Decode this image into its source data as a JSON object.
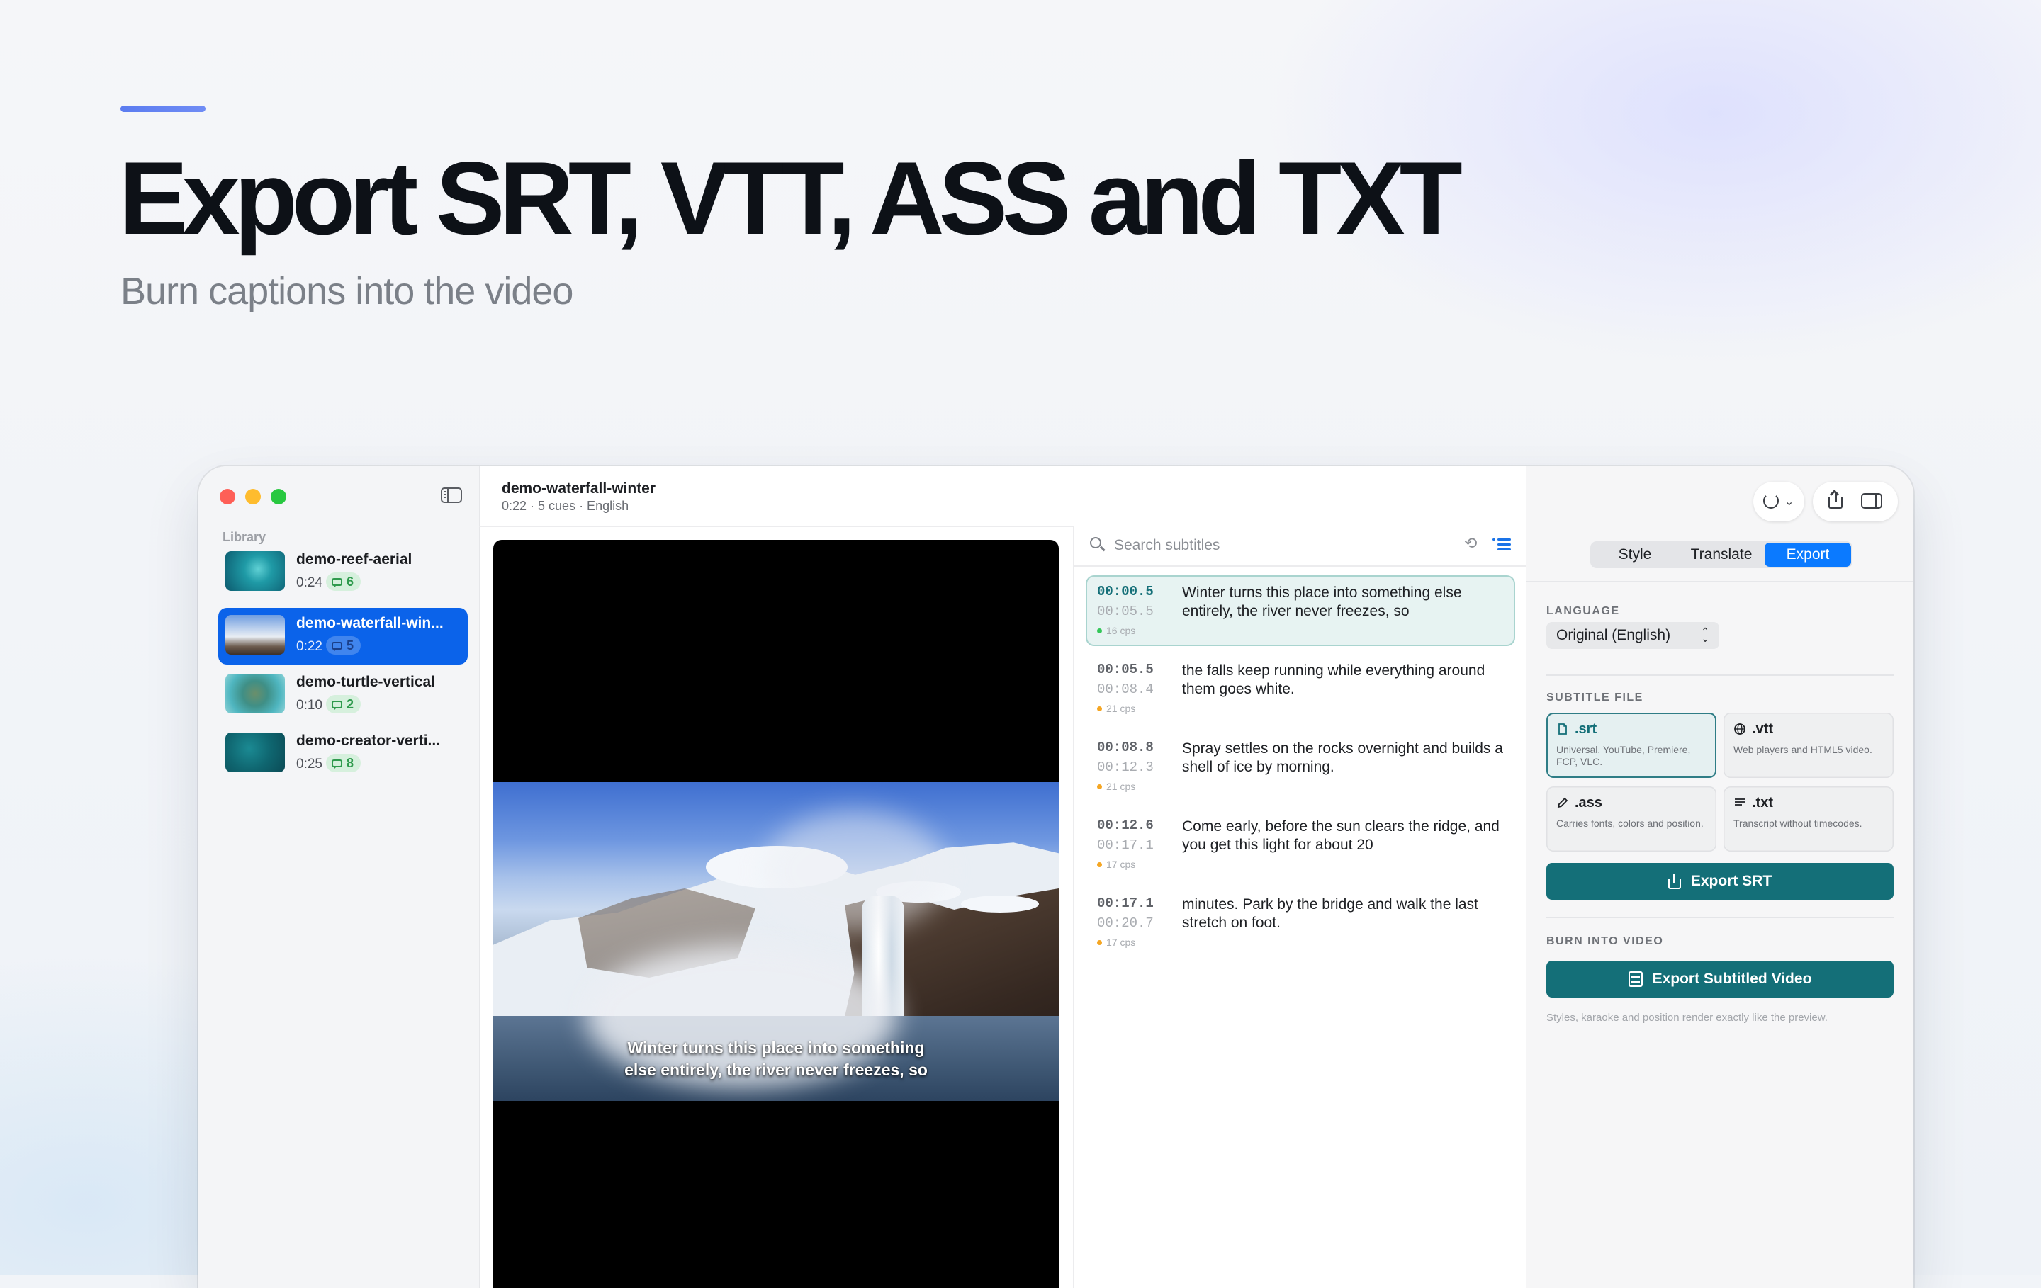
{
  "hero": {
    "headline": "Export SRT, VTT, ASS and TXT",
    "subheadline": "Burn captions into the video"
  },
  "sidebar": {
    "section_label": "Library",
    "items": [
      {
        "name": "demo-reef-aerial",
        "duration": "0:24",
        "cue_count": "6",
        "selected": false,
        "thumb_colors": [
          "#1f9aa6",
          "#0c5a6e"
        ]
      },
      {
        "name": "demo-waterfall-win...",
        "duration": "0:22",
        "cue_count": "5",
        "selected": true,
        "thumb_colors": [
          "#a9c4e6",
          "#5a5f68"
        ]
      },
      {
        "name": "demo-turtle-vertical",
        "duration": "0:10",
        "cue_count": "2",
        "selected": false,
        "thumb_colors": [
          "#4fb6c0",
          "#2b6f66"
        ]
      },
      {
        "name": "demo-creator-verti...",
        "duration": "0:25",
        "cue_count": "8",
        "selected": false,
        "thumb_colors": [
          "#13707a",
          "#0b4a55"
        ]
      }
    ]
  },
  "document": {
    "title": "demo-waterfall-winter",
    "meta": "0:22 · 5 cues · English"
  },
  "player": {
    "caption_lines": [
      "Winter turns this place into something",
      "else entirely, the river never freezes, so"
    ]
  },
  "subtitles": {
    "search_placeholder": "Search subtitles",
    "cues": [
      {
        "start": "00:00.5",
        "end": "00:05.5",
        "cps": "16 cps",
        "cps_status": "ok",
        "text": "Winter turns this place into something else entirely, the river never freezes, so",
        "active": true
      },
      {
        "start": "00:05.5",
        "end": "00:08.4",
        "cps": "21 cps",
        "cps_status": "warn",
        "text": "the falls keep running while everything around them goes white.",
        "active": false
      },
      {
        "start": "00:08.8",
        "end": "00:12.3",
        "cps": "21 cps",
        "cps_status": "warn",
        "text": "Spray settles on the rocks overnight and builds a shell of ice by morning.",
        "active": false
      },
      {
        "start": "00:12.6",
        "end": "00:17.1",
        "cps": "17 cps",
        "cps_status": "warn",
        "text": "Come early, before the sun clears the ridge, and you get this light for about 20",
        "active": false
      },
      {
        "start": "00:17.1",
        "end": "00:20.7",
        "cps": "17 cps",
        "cps_status": "warn",
        "text": "minutes. Park by the bridge and walk the last stretch on foot.",
        "active": false
      }
    ]
  },
  "inspector": {
    "tabs": [
      "Style",
      "Translate",
      "Export"
    ],
    "active_tab": "Export",
    "language_label": "LANGUAGE",
    "language_value": "Original (English)",
    "subtitle_file_label": "SUBTITLE FILE",
    "formats": [
      {
        "ext": ".srt",
        "desc": "Universal. YouTube, Premiere, FCP, VLC.",
        "icon": "document-icon",
        "selected": true
      },
      {
        "ext": ".vtt",
        "desc": "Web players and HTML5 video.",
        "icon": "globe-icon",
        "selected": false
      },
      {
        "ext": ".ass",
        "desc": "Carries fonts, colors and position.",
        "icon": "pencil-icon",
        "selected": false
      },
      {
        "ext": ".txt",
        "desc": "Transcript without timecodes.",
        "icon": "text-lines-icon",
        "selected": false
      }
    ],
    "export_button": "Export SRT",
    "burn_label": "BURN INTO VIDEO",
    "burn_button": "Export Subtitled Video",
    "burn_note": "Styles, karaoke and position render exactly like the preview."
  },
  "colors": {
    "accent_blue": "#0b7aff",
    "teal": "#146f78",
    "cps_ok": "#34c759",
    "cps_warn": "#f5a623"
  }
}
